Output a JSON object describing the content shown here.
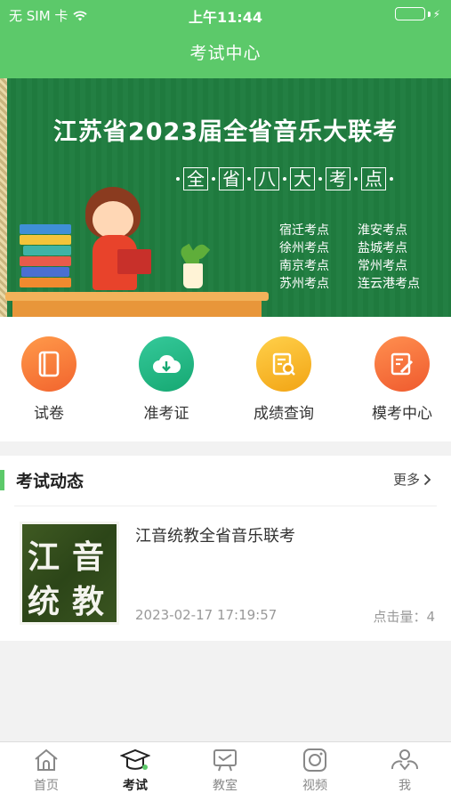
{
  "status_bar": {
    "carrier": "无 SIM 卡",
    "time": "上午11:44"
  },
  "nav": {
    "title": "考试中心"
  },
  "banner": {
    "title": "江苏省2023届全省音乐大联考",
    "subtitle_chars": [
      "全",
      "省",
      "八",
      "大",
      "考",
      "点"
    ],
    "sites": [
      "宿迁考点",
      "淮安考点",
      "徐州考点",
      "盐城考点",
      "南京考点",
      "常州考点",
      "苏州考点",
      "连云港考点"
    ]
  },
  "quick_actions": [
    {
      "label": "试卷",
      "icon": "book-icon",
      "color": "#f47a3a"
    },
    {
      "label": "准考证",
      "icon": "cloud-download-icon",
      "color": "#22b583"
    },
    {
      "label": "成绩查询",
      "icon": "search-document-icon",
      "color": "#f5b623"
    },
    {
      "label": "模考中心",
      "icon": "edit-document-icon",
      "color": "#f26c3d"
    }
  ],
  "news": {
    "title": "考试动态",
    "more": "更多",
    "articles": [
      {
        "thumb_chars": [
          "江",
          "音",
          "统",
          "教"
        ],
        "title": "江音统教全省音乐联考",
        "date": "2023-02-17 17:19:57",
        "clicks": "点击量：4"
      }
    ]
  },
  "tabs": [
    {
      "label": "首页",
      "icon": "home-icon",
      "active": false
    },
    {
      "label": "考试",
      "icon": "graduation-cap-icon",
      "active": true
    },
    {
      "label": "教室",
      "icon": "classroom-icon",
      "active": false
    },
    {
      "label": "视频",
      "icon": "video-icon",
      "active": false
    },
    {
      "label": "我",
      "icon": "profile-icon",
      "active": false
    }
  ],
  "colors": {
    "brand": "#5cc96a",
    "banner_green": "#1f7a3e"
  }
}
